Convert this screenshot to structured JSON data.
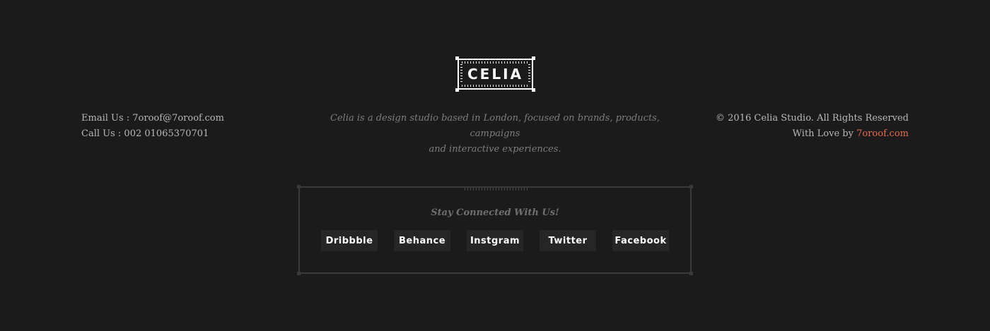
{
  "logo": {
    "text": "CELIA"
  },
  "contact": {
    "email_line": "Email Us : 7oroof@7oroof.com",
    "phone_line": "Call Us : 002 01065370701"
  },
  "about": {
    "line1": "Celia is a design studio based in London, focused on brands, products, campaigns",
    "line2": "and interactive experiences."
  },
  "copyright": {
    "line1": "© 2016 Celia Studio. All Rights Reserved",
    "love_prefix": "With Love by ",
    "love_link": "7oroof.com"
  },
  "social": {
    "title": "Stay Connected With Us!",
    "links": [
      {
        "label": "Dribbble"
      },
      {
        "label": "Behance"
      },
      {
        "label": "Instgram"
      },
      {
        "label": "Twitter"
      },
      {
        "label": "Facebook"
      }
    ]
  },
  "colors": {
    "background": "#1b1b1b",
    "accent": "#e86b4f",
    "button_bg": "#262626"
  }
}
